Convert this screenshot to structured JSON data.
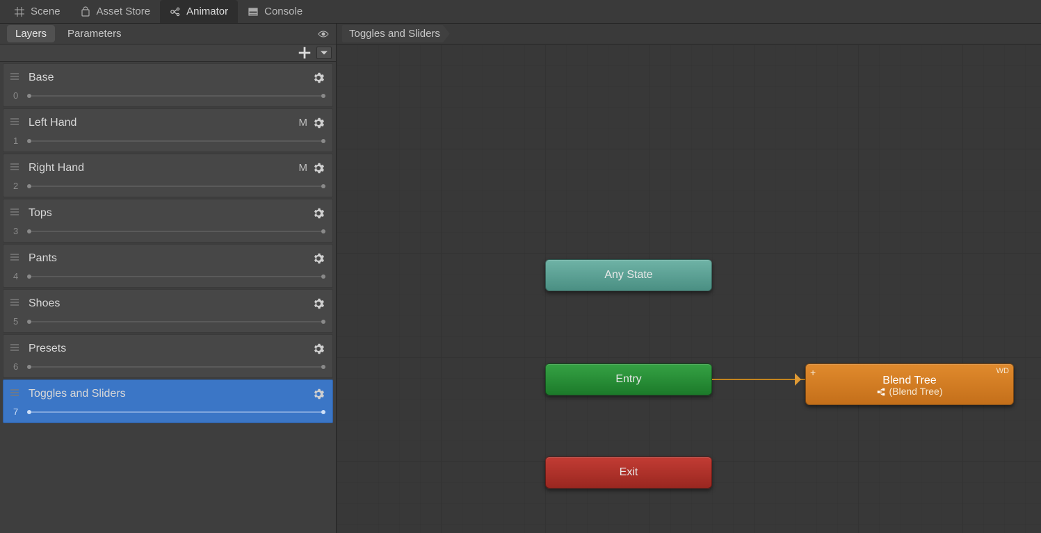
{
  "tabs": {
    "scene": "Scene",
    "asset_store": "Asset Store",
    "animator": "Animator",
    "console": "Console",
    "active": "Animator"
  },
  "sidebar": {
    "subtabs": {
      "layers": "Layers",
      "parameters": "Parameters"
    },
    "layers": [
      {
        "index": "0",
        "name": "Base"
      },
      {
        "index": "1",
        "name": "Left Hand",
        "mask": "M"
      },
      {
        "index": "2",
        "name": "Right Hand",
        "mask": "M"
      },
      {
        "index": "3",
        "name": "Tops"
      },
      {
        "index": "4",
        "name": "Pants"
      },
      {
        "index": "5",
        "name": "Shoes"
      },
      {
        "index": "6",
        "name": "Presets"
      },
      {
        "index": "7",
        "name": "Toggles and Sliders",
        "selected": true
      }
    ]
  },
  "breadcrumb": {
    "root": "Toggles and Sliders"
  },
  "graph": {
    "any_state": "Any State",
    "entry": "Entry",
    "exit": "Exit",
    "blend_tree": {
      "title": "Blend Tree",
      "sub": "(Blend Tree)",
      "wd": "WD",
      "plus": "+"
    }
  }
}
